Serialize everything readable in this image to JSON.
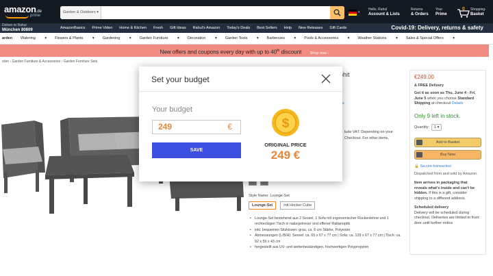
{
  "header": {
    "logo": {
      "word": "amazon",
      "tld": ".de",
      "sub": "prime"
    },
    "search": {
      "category": "Garden & Outdoors",
      "query": ""
    },
    "account": {
      "line1": "Hello, Rahul",
      "line2": "Account & Lists"
    },
    "returns": {
      "line1": "Returns",
      "line2": "& Orders"
    },
    "prime": {
      "line1": "Your",
      "line2": "Prime"
    },
    "cart": {
      "count": "0",
      "line1": "Shopping-",
      "line2": "Basket"
    }
  },
  "subnav": {
    "deliver_line1": "Deliver to Rahul",
    "deliver_line2": "München 80809",
    "links": [
      "AmazonBasics",
      "Prime Video",
      "Home & Kitchen",
      "Fresh",
      "Gift Ideas",
      "Rahul's Amazon",
      "Today's Deals",
      "Best Sellers",
      "Help",
      "New Releases",
      "Gift Cards"
    ],
    "covid": "Covid-19: Delivery, returns & safety"
  },
  "catnav": {
    "first": "arden",
    "items": [
      "Watering",
      "Flowers & Plants",
      "Gardening",
      "Garden Furniture",
      "Decoration",
      "Garden Tools",
      "Barbecues",
      "Pools & Accessories",
      "Weather Stations",
      "Sales & Special Offers"
    ]
  },
  "banner": {
    "text": "New offers and coupons every day with up to 40",
    "sup": "th",
    "text_end": " discount",
    "shop": "Shop now ›"
  },
  "breadcrumb": "rden  ›  Garden Furniture & Accessories  ›  Garden Furniture Sets",
  "product": {
    "title_fragment": "rephit",
    "link_fragment": "tions",
    "vat_text": "lude VAT. Depending on your Checkout. For other items,",
    "style_label": "Style Name: ",
    "style_value": "Lounge-Set",
    "options": [
      "Lounge-Set",
      "mit Hocker Cube"
    ],
    "bullets": [
      "Lounge-Set bestehend aus 2 Sessel, 1 Sofa mit ergonomischer Rückenlehne und 1 rechteckigen Tisch in naturgetreuer und offener Rattanoptik",
      "inkl. bequemen Sitzkissen: grau, ca. 6 cm Stärke, Polyester",
      "Abmessungen (L/B/H): Sessel: ca. 65 x 67 x 77 cm | Sofa: ca. 129 x 67 x 77 cm | Tisch: ca. 92 x 59 x 43 cm",
      "hergestellt aus UV- und wetterbeständigen, hochwertigen Polypropylen"
    ]
  },
  "buybox": {
    "price": "€249.00",
    "free_delivery": "& FREE Delivery",
    "get_it_prefix": "Get it as soon as ",
    "get_it_date": "Thu, June 4 - Fri, June 5",
    "get_it_mid": " when you choose ",
    "get_it_shipping": "Standard Shipping",
    "get_it_suffix": " at checkout ",
    "details": "Details",
    "stock": "Only 9 left in stock.",
    "qty_label": "Quantity:",
    "qty_value": "1",
    "add_basket": "Add to Basket",
    "buy_now": "Buy Now",
    "secure": "Secure transaction",
    "dispatched": "Dispatched from and sold by Amazon.",
    "gift_bold": "Item arrives in packaging that reveals what's inside and can't be hidden.",
    "gift_rest": " If this is a gift, consider shipping to a different address.",
    "sched_title": "Scheduled delivery",
    "sched_text": "Delivery will be scheduled during checkout. Deliveries are limited to front door until further notice"
  },
  "modal": {
    "title": "Set your budget",
    "budget_label": "Your budget",
    "budget_value": "249",
    "currency": "€",
    "save_label": "SAVE",
    "original_label": "ORIGINAL PRICE",
    "original_value": "249 €"
  },
  "colors": {
    "header_bg": "#131921",
    "subnav_bg": "#232f3e",
    "banner_bg": "#f28b82",
    "accent_orange": "#e8863a",
    "save_blue": "#3d4fe0",
    "price_red": "#b12704",
    "stock_green": "#007600"
  },
  "icons": {
    "search": "search-icon",
    "cart": "cart-icon",
    "close": "close-icon",
    "coin": "dollar-coin-icon",
    "flag": "germany-flag-icon"
  }
}
